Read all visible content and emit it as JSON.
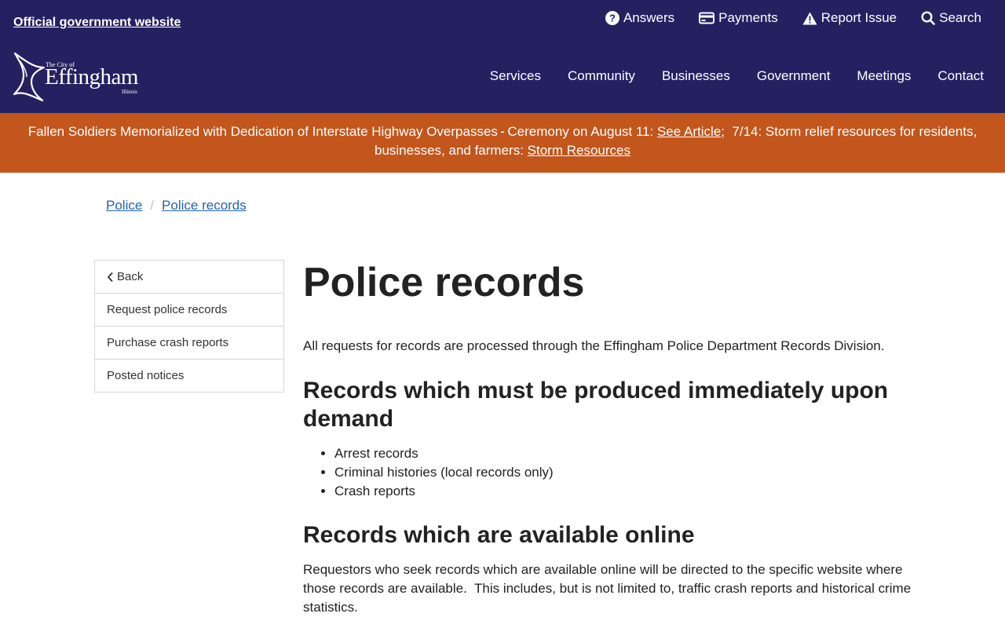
{
  "header": {
    "official_label": "Official government website",
    "utility_links": [
      {
        "label": "Answers",
        "icon": "question-circle-icon"
      },
      {
        "label": "Payments",
        "icon": "credit-card-icon"
      },
      {
        "label": "Report Issue",
        "icon": "warning-triangle-icon"
      },
      {
        "label": "Search",
        "icon": "search-icon"
      }
    ],
    "logo": {
      "small": "The City of",
      "big": "Effingham",
      "state": "Illinois"
    },
    "nav": [
      "Services",
      "Community",
      "Businesses",
      "Government",
      "Meetings",
      "Contact"
    ]
  },
  "alert": {
    "text1": "Fallen Soldiers Memorialized with Dedication of Interstate Highway Overpasses - Ceremony on August 11: ",
    "link1": "See Article",
    "text2": ";  7/14: Storm relief resources for residents, businesses, and farmers: ",
    "link2": "Storm Resources"
  },
  "breadcrumb": {
    "items": [
      "Police",
      "Police records"
    ],
    "separator": "/"
  },
  "sidenav": {
    "back_label": "Back",
    "items": [
      "Request police records",
      "Purchase crash reports",
      "Posted notices"
    ]
  },
  "main": {
    "title": "Police records",
    "intro": "All requests for records are processed through the Effingham Police Department Records Division.",
    "section1": {
      "heading": "Records which must be produced immediately upon demand",
      "items": [
        "Arrest records",
        "Criminal histories (local records only)",
        "Crash reports"
      ]
    },
    "section2": {
      "heading": "Records which are available online",
      "paragraph": "Requestors who seek records which are available online will be directed to the specific website where those records are available.  This includes, but is not limited to, traffic crash reports and historical crime statistics."
    }
  },
  "colors": {
    "header_bg": "#252161",
    "alert_bg": "#c2561c",
    "link": "#1f63b3"
  }
}
